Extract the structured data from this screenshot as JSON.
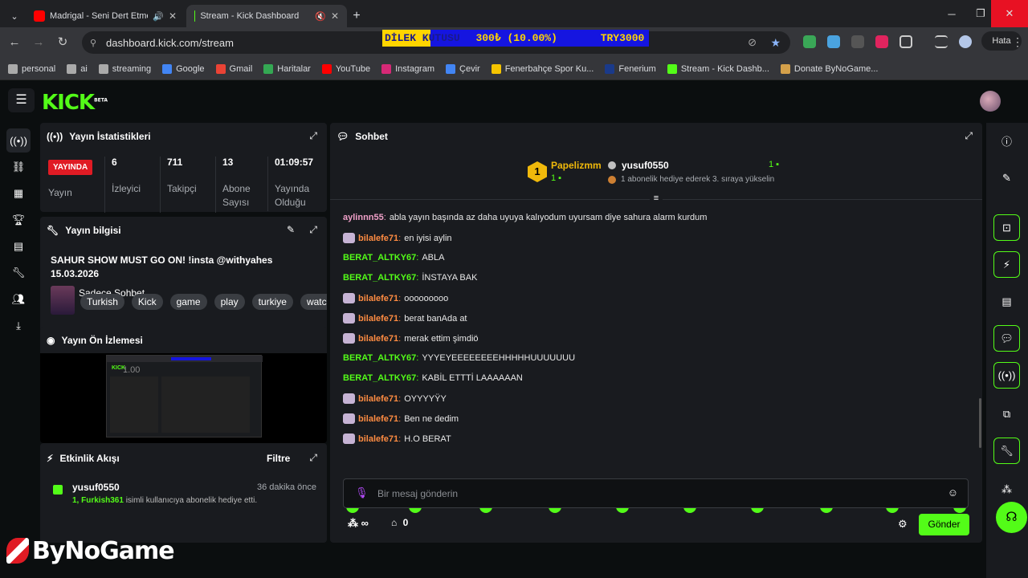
{
  "tabs": [
    {
      "title": "Madrigal - Seni Dert Etmeler",
      "favicon_color": "#ff0000"
    },
    {
      "title": "Stream - Kick Dashboard",
      "favicon_color": "#53fc18"
    }
  ],
  "url": "dashboard.kick.com/stream",
  "donation_bar": {
    "label": "DİLEK KUTUSU",
    "amount": "300₺ (10.00%)",
    "goal": "TRY3000",
    "progress": 0.1
  },
  "profile_button": "Hata",
  "bookmarks": [
    {
      "label": "personal",
      "icon_color": "#aaa"
    },
    {
      "label": "ai",
      "icon_color": "#aaa"
    },
    {
      "label": "streaming",
      "icon_color": "#aaa"
    },
    {
      "label": "Google",
      "icon_color": "#4285f4"
    },
    {
      "label": "Gmail",
      "icon_color": "#ea4335"
    },
    {
      "label": "Haritalar",
      "icon_color": "#34a853"
    },
    {
      "label": "YouTube",
      "icon_color": "#ff0000"
    },
    {
      "label": "Instagram",
      "icon_color": "#d62976"
    },
    {
      "label": "Çevir",
      "icon_color": "#4285f4"
    },
    {
      "label": "Fenerbahçe Spor Ku...",
      "icon_color": "#f5c400"
    },
    {
      "label": "Fenerium",
      "icon_color": "#1a3a8a"
    },
    {
      "label": "Stream - Kick Dashb...",
      "icon_color": "#53fc18"
    },
    {
      "label": "Donate ByNoGame...",
      "icon_color": "#d4a04a"
    }
  ],
  "stats": {
    "title": "Yayın İstatistikleri",
    "live_badge": "YAYINDA",
    "items": [
      {
        "value": "",
        "label": "Yayın"
      },
      {
        "value": "6",
        "label": "İzleyici"
      },
      {
        "value": "711",
        "label": "Takipçi"
      },
      {
        "value": "13",
        "label": "Abone Sayısı"
      },
      {
        "value": "01:09:57",
        "label": "Yayında Olduğu Sü..."
      }
    ]
  },
  "info": {
    "title": "Yayın bilgisi",
    "stream_title": "SAHUR SHOW MUST GO ON! !insta @withyahes 15.03.2026",
    "category": "Sadece Sohbet",
    "tags": [
      "Turkish",
      "Kick",
      "game",
      "play",
      "turkiye",
      "watch"
    ]
  },
  "preview": {
    "title": "Yayın Ön İzlemesi",
    "overlay": "1.00"
  },
  "activity": {
    "title": "Etkinlik Akışı",
    "filter": "Filtre",
    "events": [
      {
        "user": "yusuf0550",
        "time": "36 dakika önce",
        "detail_highlight": "1, Furkish361",
        "detail_rest": " isimli kullanıcıya abonelik hediye etti."
      }
    ]
  },
  "chat": {
    "title": "Sohbet",
    "leaderboard": {
      "first": {
        "rank": "1",
        "name": "Papelizmm",
        "count": "1"
      },
      "second": {
        "name": "yusuf0550",
        "count": "1",
        "note": "1 abonelik hediye ederek 3. sıraya yükselin"
      }
    },
    "messages": [
      {
        "user": "aylinnn55",
        "text": "abla yayın başında az daha uyuya kalıyodum uyursam diye sahura alarm kurdum",
        "color": "#f0a0c8",
        "badge": false
      },
      {
        "user": "bilalefe71",
        "text": "en iyisi aylin",
        "color": "#ff8c42",
        "badge": true
      },
      {
        "user": "BERAT_ALTKY67",
        "text": "ABLA",
        "color": "#53fc18",
        "badge": false
      },
      {
        "user": "BERAT_ALTKY67",
        "text": "İNSTAYA BAK",
        "color": "#53fc18",
        "badge": false
      },
      {
        "user": "bilalefe71",
        "text": "ooooooooo",
        "color": "#ff8c42",
        "badge": true
      },
      {
        "user": "bilalefe71",
        "text": "berat banAda at",
        "color": "#ff8c42",
        "badge": true
      },
      {
        "user": "bilalefe71",
        "text": "merak ettim şimdiö",
        "color": "#ff8c42",
        "badge": true
      },
      {
        "user": "BERAT_ALTKY67",
        "text": "YYYEYEEEEEEEEHHHHHUUUUUUU",
        "color": "#53fc18",
        "badge": false
      },
      {
        "user": "BERAT_ALTKY67",
        "text": "KABİL ETTTİ LAAAAAAN",
        "color": "#53fc18",
        "badge": false
      },
      {
        "user": "bilalefe71",
        "text": "OYYYYŸY",
        "color": "#ff8c42",
        "badge": true
      },
      {
        "user": "bilalefe71",
        "text": "Ben ne dedim",
        "color": "#ff8c42",
        "badge": true
      },
      {
        "user": "bilalefe71",
        "text": "H.O BERAT",
        "color": "#ff8c42",
        "badge": true
      }
    ],
    "input_placeholder": "Bir mesaj gönderin",
    "points": "∞",
    "store_count": "0",
    "send": "Gönder"
  },
  "watermark": "ByNoGame"
}
